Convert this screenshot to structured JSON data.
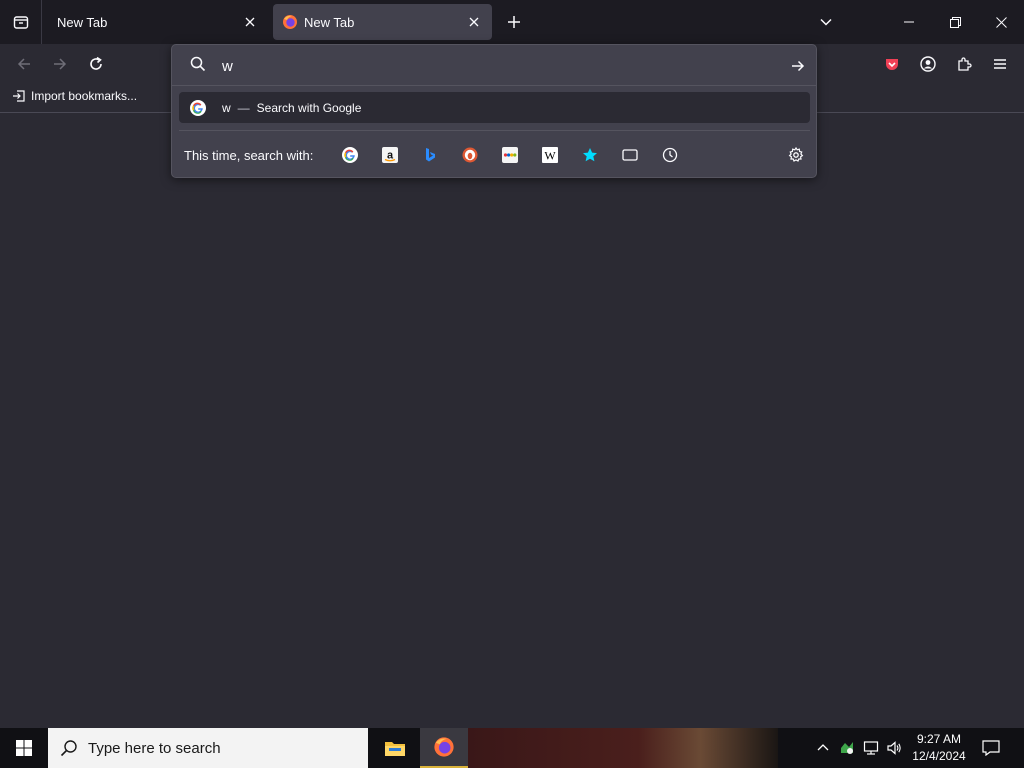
{
  "tabs": [
    {
      "title": "New Tab",
      "active": false
    },
    {
      "title": "New Tab",
      "active": true
    }
  ],
  "bookmarks": {
    "import_label": "Import bookmarks..."
  },
  "urlbar": {
    "value": "w",
    "suggestion": {
      "query": "w",
      "separator": "—",
      "action": "Search with Google"
    },
    "oneoff_label": "This time, search with:",
    "oneoffs": [
      "google-icon",
      "amazon-icon",
      "bing-icon",
      "duckduckgo-icon",
      "ebay-icon",
      "wikipedia-icon",
      "bookmarks-star-icon",
      "tabs-icon",
      "history-icon"
    ]
  },
  "toolbar_icons": [
    "back-icon",
    "forward-icon",
    "reload-icon",
    "pocket-icon",
    "account-icon",
    "extensions-icon",
    "menu-icon"
  ],
  "taskbar": {
    "search_placeholder": "Type here to search",
    "time": "9:27 AM",
    "date": "12/4/2024"
  },
  "colors": {
    "tab_bg": "#1c1b22",
    "toolbar_bg": "#2b2a33",
    "popup_bg": "#42414d",
    "pocket_red": "#ef4056",
    "accent_blue": "#00ddff"
  }
}
